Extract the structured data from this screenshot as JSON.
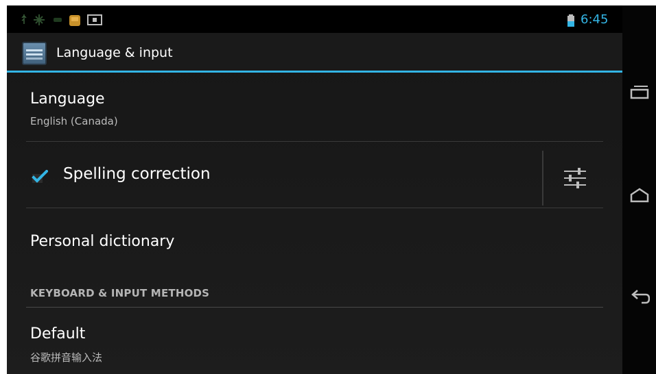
{
  "status_bar": {
    "time": "6:45",
    "icons": [
      "usb-icon",
      "android-debug-icon",
      "signal-icon",
      "sd-card-icon",
      "screenshot-icon",
      "battery-icon"
    ]
  },
  "action_bar": {
    "title": "Language & input",
    "icon": "settings-app-icon"
  },
  "language": {
    "title": "Language",
    "summary": "English (Canada)"
  },
  "spelling": {
    "label": "Spelling correction",
    "checked": true
  },
  "personal_dictionary": {
    "title": "Personal dictionary"
  },
  "keyboard_section": {
    "header": "KEYBOARD & INPUT METHODS"
  },
  "default_ime": {
    "title": "Default",
    "summary": "谷歌拼音输入法"
  },
  "nav_bar": {
    "buttons": [
      "recent-apps-icon",
      "home-icon",
      "back-icon"
    ]
  },
  "colors": {
    "accent": "#33b5e5",
    "background": "#1a1a1a",
    "text": "#ffffff"
  }
}
